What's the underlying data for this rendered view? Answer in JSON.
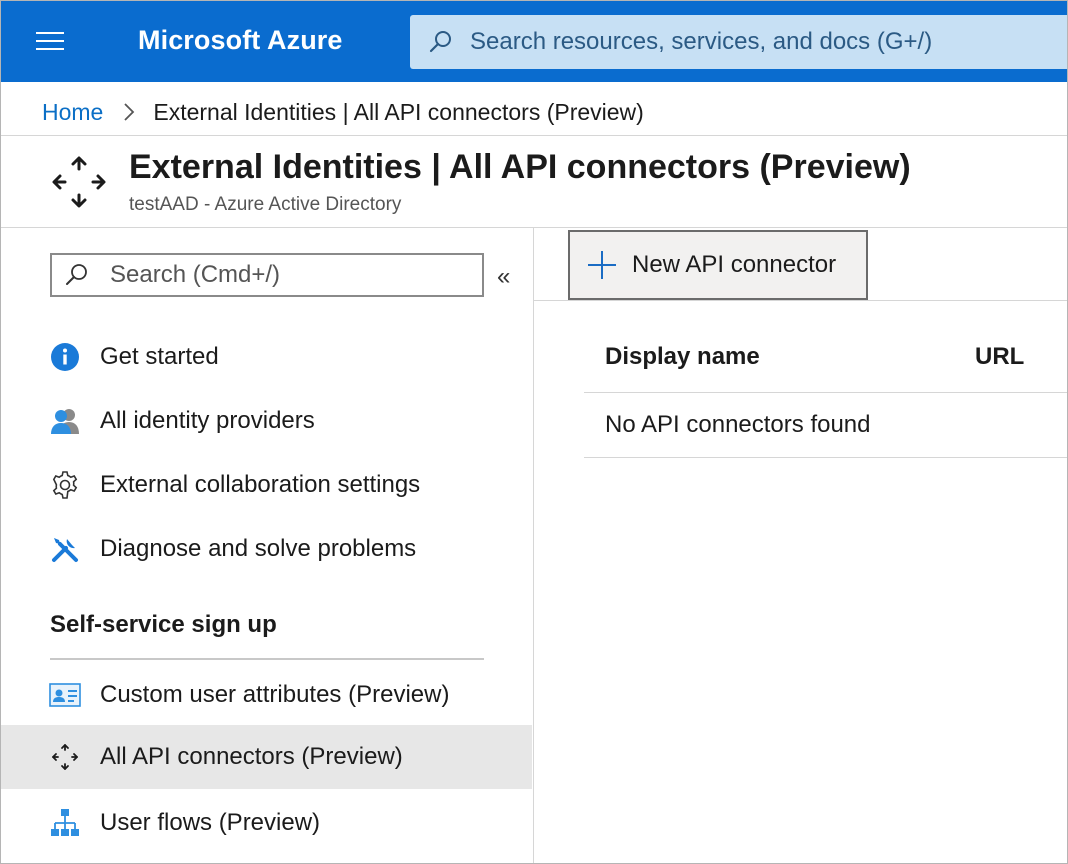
{
  "header": {
    "brand": "Microsoft Azure",
    "search_placeholder": "Search resources, services, and docs (G+/)",
    "accent": "#0a6ccf"
  },
  "breadcrumb": {
    "home": "Home",
    "current": "External Identities | All API connectors (Preview)"
  },
  "page": {
    "title": "External Identities | All API connectors (Preview)",
    "subtitle": "testAAD - Azure Active Directory",
    "icon": "api-connector-arrows-icon"
  },
  "sidebar": {
    "search_placeholder": "Search (Cmd+/)",
    "collapse_glyph": "«",
    "items": [
      {
        "label": "Get started",
        "icon": "info-icon"
      },
      {
        "label": "All identity providers",
        "icon": "users-icon"
      },
      {
        "label": "External collaboration settings",
        "icon": "gear-icon"
      },
      {
        "label": "Diagnose and solve problems",
        "icon": "wrench-icon"
      }
    ],
    "section_title": "Self-service sign up",
    "section_items": [
      {
        "label": "Custom user attributes (Preview)",
        "icon": "id-card-icon"
      },
      {
        "label": "All API connectors (Preview)",
        "icon": "api-connector-arrows-icon",
        "active": true
      },
      {
        "label": "User flows (Preview)",
        "icon": "flow-icon"
      }
    ]
  },
  "toolbar": {
    "new_label": "New API connector"
  },
  "table": {
    "columns": [
      "Display name",
      "URL"
    ],
    "empty_message": "No API connectors found"
  }
}
